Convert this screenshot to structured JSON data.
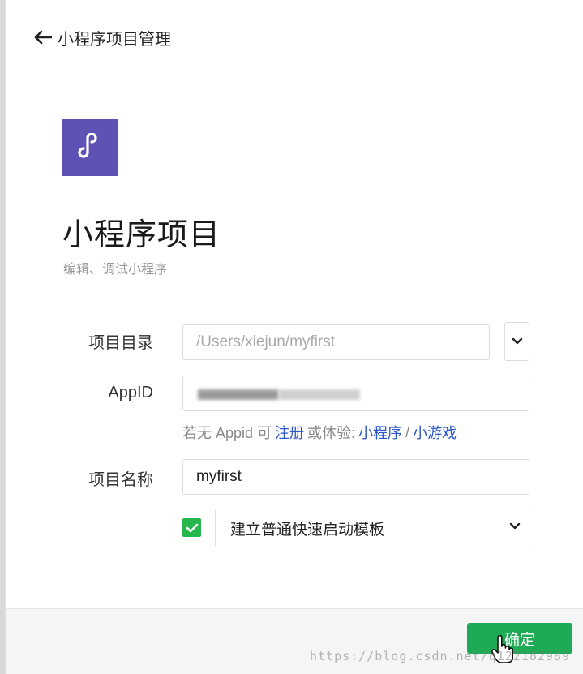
{
  "header": {
    "back_title": "小程序项目管理"
  },
  "hero": {
    "title": "小程序项目",
    "subtitle": "编辑、调试小程序"
  },
  "form": {
    "dir_label": "项目目录",
    "dir_placeholder": "/Users/xiejun/myfirst",
    "appid_label": "AppID",
    "hint_prefix": "若无 Appid 可",
    "hint_register": "注册",
    "hint_middle": "或体验:",
    "hint_miniprogram": "小程序",
    "hint_sep": "/",
    "hint_minigame": "小游戏",
    "name_label": "项目名称",
    "name_value": "myfirst",
    "template_checked": true,
    "template_option": "建立普通快速启动模板"
  },
  "footer": {
    "confirm_label": "确定"
  },
  "watermark": "https://blog.csdn.net/q122182989",
  "colors": {
    "accent_green": "#1faa56",
    "logo_purple": "#5e52b5",
    "link_blue": "#2b57c9"
  }
}
